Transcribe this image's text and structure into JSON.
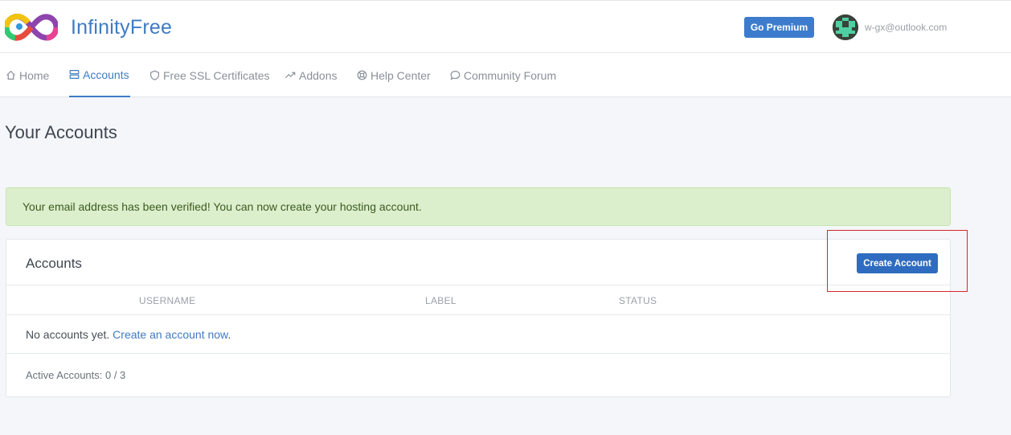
{
  "brand": {
    "name": "InfinityFree"
  },
  "header": {
    "premium_label": "Go Premium",
    "user_email": "w-gx@outlook.com"
  },
  "nav": {
    "items": [
      {
        "label": "Home",
        "icon": "home-icon"
      },
      {
        "label": "Accounts",
        "icon": "server-icon",
        "active": true
      },
      {
        "label": "Free SSL Certificates",
        "icon": "shield-icon"
      },
      {
        "label": "Addons",
        "icon": "trending-icon"
      },
      {
        "label": "Help Center",
        "icon": "lifebuoy-icon"
      },
      {
        "label": "Community Forum",
        "icon": "chat-icon"
      }
    ]
  },
  "page": {
    "title": "Your Accounts"
  },
  "alert": {
    "message": "Your email address has been verified! You can now create your hosting account."
  },
  "accounts_card": {
    "title": "Accounts",
    "create_button": "Create Account",
    "columns": [
      "USERNAME",
      "LABEL",
      "STATUS"
    ],
    "empty_text": "No accounts yet.",
    "empty_link": "Create an account now",
    "empty_suffix": ".",
    "active_accounts": "Active Accounts: 0 / 3"
  },
  "colors": {
    "brand_blue": "#3e7bc4",
    "button_blue": "#2f6cc0",
    "alert_green_bg": "#dcefcd",
    "highlight_red": "#d9262d"
  }
}
